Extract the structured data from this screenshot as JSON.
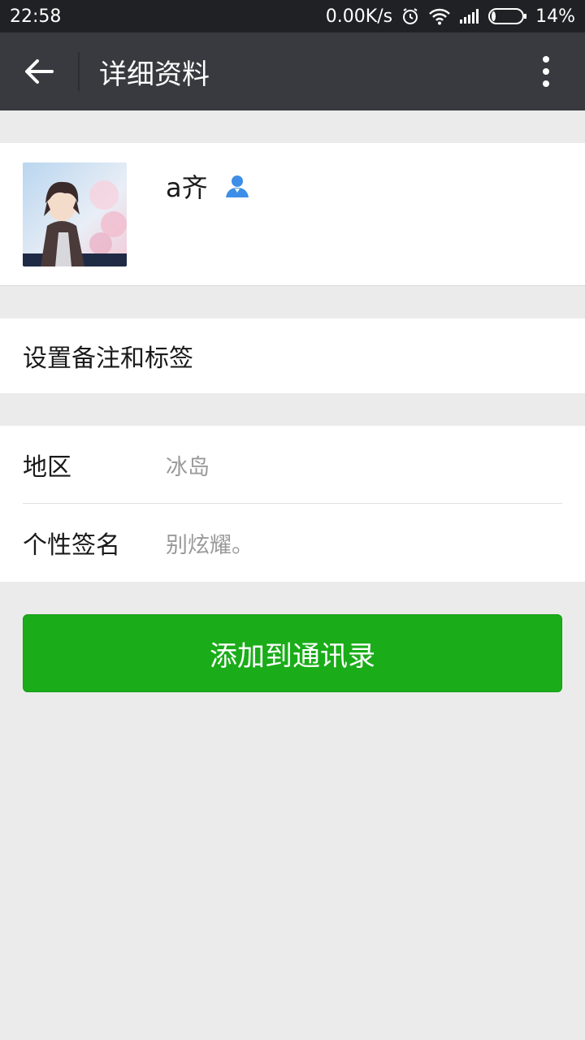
{
  "status_bar": {
    "time": "22:58",
    "network_speed": "0.00K/s",
    "battery": "14%",
    "battery_level": 0.14,
    "icons": [
      "alarm-icon",
      "wifi-icon",
      "signal-icon",
      "battery-icon"
    ]
  },
  "app_bar": {
    "title": "详细资料",
    "back_icon": "arrow-left-icon",
    "more_icon": "more-vertical-icon"
  },
  "profile": {
    "name": "a齐",
    "badge_icon": "person-icon"
  },
  "remark": {
    "label": "设置备注和标签"
  },
  "info": {
    "rows": [
      {
        "label": "地区",
        "value": "冰岛"
      },
      {
        "label": "个性签名",
        "value": "别炫耀。"
      }
    ]
  },
  "actions": {
    "add_label": "添加到通讯录"
  },
  "colors": {
    "status_bar": "#202124",
    "app_bar": "#393a3f",
    "background": "#ebebeb",
    "primary_button": "#1aad19",
    "badge_blue": "#3d8ee6"
  }
}
